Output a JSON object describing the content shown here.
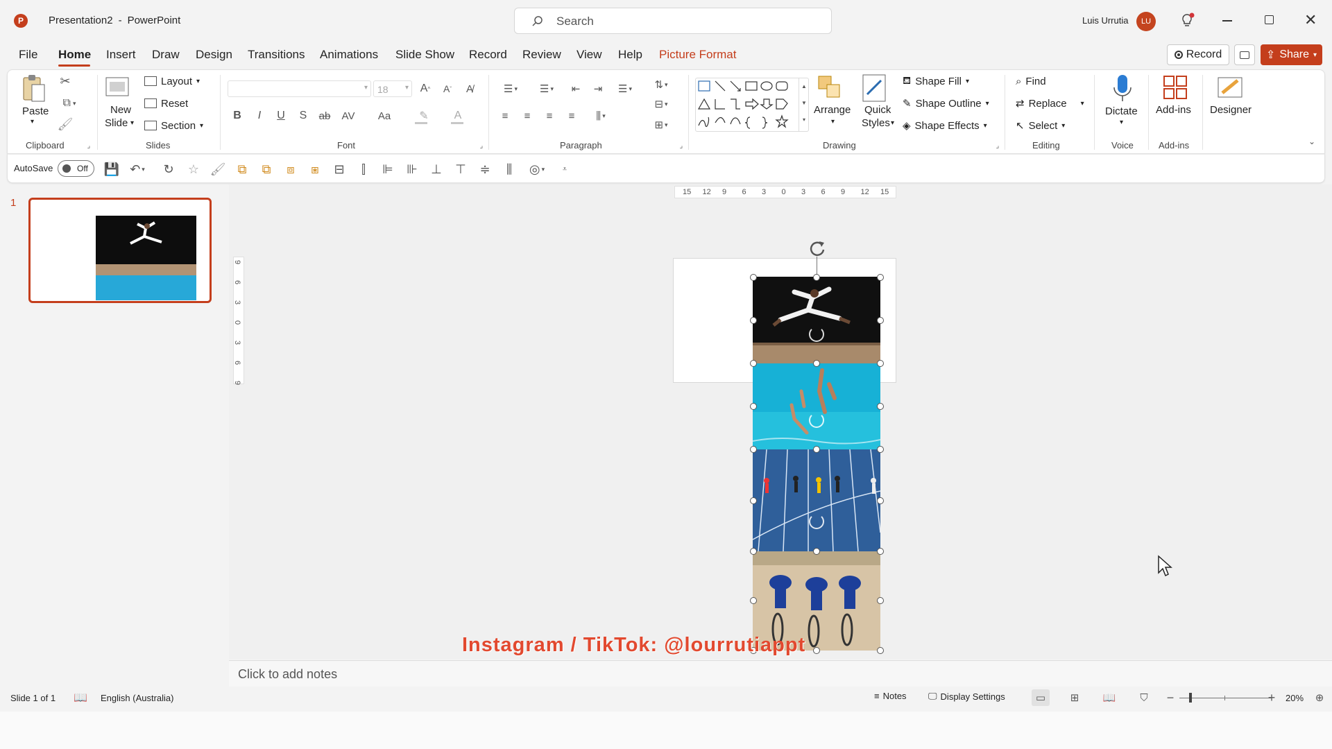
{
  "titlebar": {
    "doc_title": "Presentation2",
    "separator": "-",
    "app_name": "PowerPoint",
    "search_placeholder": "Search",
    "user_name": "Luis Urrutia",
    "user_initials": "LU"
  },
  "menu": {
    "tabs": [
      "File",
      "Home",
      "Insert",
      "Draw",
      "Design",
      "Transitions",
      "Animations",
      "Slide Show",
      "Record",
      "Review",
      "View",
      "Help",
      "Picture Format"
    ],
    "active": "Home",
    "record_label": "Record",
    "share_label": "Share"
  },
  "ribbon": {
    "clipboard": {
      "paste": "Paste",
      "group": "Clipboard"
    },
    "slides": {
      "new_slide_1": "New",
      "new_slide_2": "Slide",
      "layout": "Layout",
      "reset": "Reset",
      "section": "Section",
      "group": "Slides"
    },
    "font": {
      "font_size": "18",
      "group": "Font",
      "bold": "B",
      "italic": "I",
      "underline": "U",
      "shadow": "S",
      "strike": "ab",
      "spacing": "AV",
      "case": "Aa"
    },
    "paragraph": {
      "group": "Paragraph"
    },
    "drawing": {
      "arrange": "Arrange",
      "quick_styles_1": "Quick",
      "quick_styles_2": "Styles",
      "shape_fill": "Shape Fill",
      "shape_outline": "Shape Outline",
      "shape_effects": "Shape Effects",
      "group": "Drawing"
    },
    "editing": {
      "find": "Find",
      "replace": "Replace",
      "select": "Select",
      "group": "Editing"
    },
    "voice": {
      "dictate": "Dictate",
      "group": "Voice"
    },
    "addins": {
      "addins": "Add-ins",
      "group": "Add-ins"
    },
    "designer": {
      "designer": "Designer"
    }
  },
  "qat": {
    "autosave": "AutoSave",
    "toggle": "Off"
  },
  "thumb": {
    "number": "1"
  },
  "ruler": {
    "h_ticks": [
      "15",
      "12",
      "9",
      "6",
      "3",
      "0",
      "3",
      "6",
      "9",
      "12",
      "15"
    ],
    "v_ticks": [
      "9",
      "6",
      "3",
      "0",
      "3",
      "6",
      "9"
    ]
  },
  "watermark": "Instagram / TikTok: @lourrutiappt",
  "notes_placeholder": "Click to add notes",
  "status": {
    "slide_info": "Slide 1 of 1",
    "language": "English (Australia)",
    "notes": "Notes",
    "display_settings": "Display Settings",
    "zoom": "20%"
  },
  "colors": {
    "accent": "#c43e1c",
    "picture_format": "#c43e1c",
    "watermark": "#e2492f"
  }
}
